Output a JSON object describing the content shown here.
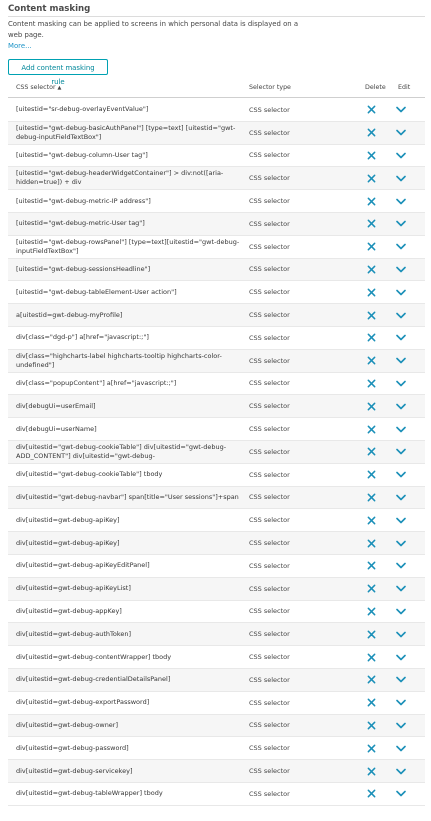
{
  "section": {
    "title": "Content masking",
    "description": "Content masking can be applied to screens in which personal data is displayed on a web page.",
    "more_link": "More..."
  },
  "add_button_label": "Add content masking rule",
  "table": {
    "headers": {
      "selector": "CSS selector",
      "selector_type": "Selector type",
      "delete": "Delete",
      "edit": "Edit"
    },
    "sort_indicator": "▲",
    "rows": [
      {
        "selector": "[uitestid=\"sr-debug-overlayEventValue\"]",
        "type": "CSS selector"
      },
      {
        "selector": "[uitestid=\"gwt-debug-basicAuthPanel\"] [type=text] [uitestid=\"gwt-debug-inputFieldTextBox\"]",
        "type": "CSS selector"
      },
      {
        "selector": "[uitestid=\"gwt-debug-column-User tag\"]",
        "type": "CSS selector"
      },
      {
        "selector": "[uitestid=\"gwt-debug-headerWidgetContainer\"] > div:not([aria-hidden=true]) + div",
        "type": "CSS selector"
      },
      {
        "selector": "[uitestid=\"gwt-debug-metric-IP address\"]",
        "type": "CSS selector"
      },
      {
        "selector": "[uitestid=\"gwt-debug-metric-User tag\"]",
        "type": "CSS selector"
      },
      {
        "selector": "[uitestid=\"gwt-debug-rowsPanel\"] [type=text][uitestid=\"gwt-debug-inputFieldTextBox\"]",
        "type": "CSS selector"
      },
      {
        "selector": "[uitestid=\"gwt-debug-sessionsHeadline\"]",
        "type": "CSS selector"
      },
      {
        "selector": "[uitestid=\"gwt-debug-tableElement-User action\"]",
        "type": "CSS selector"
      },
      {
        "selector": "a[uitestid=gwt-debug-myProfile]",
        "type": "CSS selector"
      },
      {
        "selector": "div[class=\"dgd-p\"] a[href=\"javascript:;\"]",
        "type": "CSS selector"
      },
      {
        "selector": "div[class=\"highcharts-label highcharts-tooltip highcharts-color-undefined\"]",
        "type": "CSS selector"
      },
      {
        "selector": "div[class=\"popupContent\"] a[href=\"javascript:;\"]",
        "type": "CSS selector"
      },
      {
        "selector": "div[debugUi=userEmail]",
        "type": "CSS selector"
      },
      {
        "selector": "div[debugUi=userName]",
        "type": "CSS selector"
      },
      {
        "selector": "div[uitestid=\"gwt-debug-cookieTable\"] div[uitestid=\"gwt-debug-ADD_CONTENT\"] div[uitestid=\"gwt-debug-",
        "type": "CSS selector"
      },
      {
        "selector": "div[uitestid=\"gwt-debug-cookieTable\"] tbody",
        "type": "CSS selector"
      },
      {
        "selector": "div[uitestid=\"gwt-debug-navbar\"] span[title=\"User sessions\"]+span",
        "type": "CSS selector"
      },
      {
        "selector": "div[uitestid=gwt-debug-apiKey]",
        "type": "CSS selector"
      },
      {
        "selector": "div[uitestid=gwt-debug-apiKey]",
        "type": "CSS selector"
      },
      {
        "selector": "div[uitestid=gwt-debug-apiKeyEditPanel]",
        "type": "CSS selector"
      },
      {
        "selector": "div[uitestid=gwt-debug-apiKeyList]",
        "type": "CSS selector"
      },
      {
        "selector": "div[uitestid=gwt-debug-appKey]",
        "type": "CSS selector"
      },
      {
        "selector": "div[uitestid=gwt-debug-authToken]",
        "type": "CSS selector"
      },
      {
        "selector": "div[uitestid=gwt-debug-contentWrapper] tbody",
        "type": "CSS selector"
      },
      {
        "selector": "div[uitestid=gwt-debug-credentialDetailsPanel]",
        "type": "CSS selector"
      },
      {
        "selector": "div[uitestid=gwt-debug-exportPassword]",
        "type": "CSS selector"
      },
      {
        "selector": "div[uitestid=gwt-debug-owner]",
        "type": "CSS selector"
      },
      {
        "selector": "div[uitestid=gwt-debug-password]",
        "type": "CSS selector"
      },
      {
        "selector": "div[uitestid=gwt-debug-servicekey]",
        "type": "CSS selector"
      },
      {
        "selector": "div[uitestid=gwt-debug-tableWrapper] tbody",
        "type": "CSS selector"
      }
    ]
  },
  "icons": {
    "delete": "close-icon",
    "edit": "chevron-down-icon"
  },
  "colors": {
    "accent": "#00a1b2",
    "icon": "#1a8fb8",
    "link": "#1d93c7"
  }
}
